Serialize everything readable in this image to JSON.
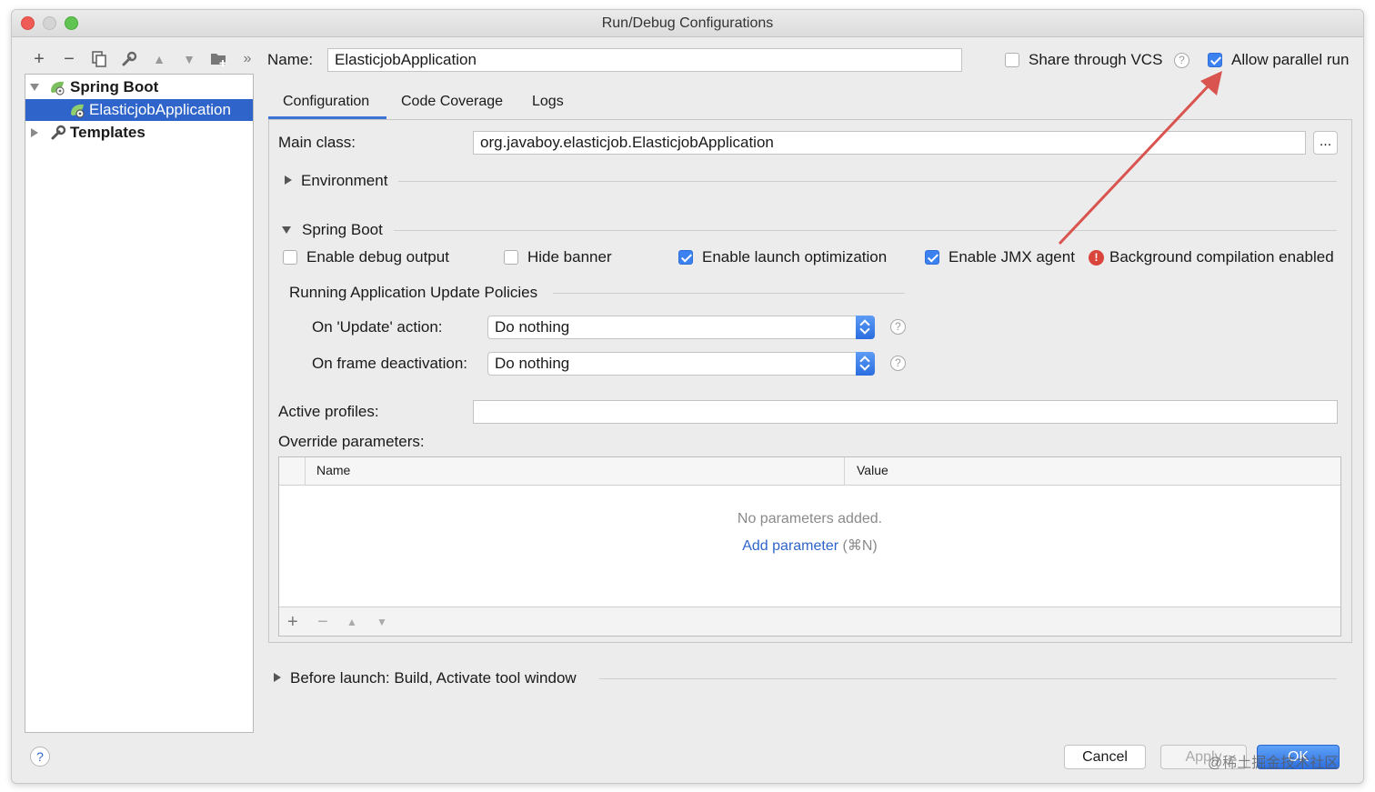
{
  "window": {
    "title": "Run/Debug Configurations"
  },
  "tree": {
    "groups": [
      {
        "label": "Spring Boot",
        "children": [
          {
            "label": "ElasticjobApplication",
            "selected": true
          }
        ]
      },
      {
        "label": "Templates"
      }
    ]
  },
  "header": {
    "name_label": "Name:",
    "name_value": "ElasticjobApplication",
    "share_vcs_label": "Share through VCS",
    "share_vcs_checked": false,
    "allow_parallel_label": "Allow parallel run",
    "allow_parallel_checked": true
  },
  "tabs": [
    {
      "label": "Configuration",
      "active": true
    },
    {
      "label": "Code Coverage",
      "active": false
    },
    {
      "label": "Logs",
      "active": false
    }
  ],
  "config": {
    "main_class_label": "Main class:",
    "main_class_value": "org.javaboy.elasticjob.ElasticjobApplication",
    "browse_label": "...",
    "environment_label": "Environment",
    "spring_boot_label": "Spring Boot",
    "options": [
      {
        "label": "Enable debug output",
        "checked": false
      },
      {
        "label": "Hide banner",
        "checked": false
      },
      {
        "label": "Enable launch optimization",
        "checked": true
      },
      {
        "label": "Enable JMX agent",
        "checked": true
      }
    ],
    "bg_compilation_icon": "!",
    "bg_compilation_label": "Background compilation enabled",
    "update_policies_label": "Running Application Update Policies",
    "on_update_label": "On 'Update' action:",
    "on_update_value": "Do nothing",
    "on_frame_label": "On frame deactivation:",
    "on_frame_value": "Do nothing",
    "help_glyph": "?",
    "active_profiles_label": "Active profiles:",
    "active_profiles_value": "",
    "override_label": "Override parameters:",
    "table": {
      "columns": [
        "Name",
        "Value"
      ],
      "empty_text": "No parameters added.",
      "add_link": "Add parameter",
      "add_shortcut": "(⌘N)"
    },
    "table_toolbar": {
      "add": "+",
      "remove": "−",
      "up": "▲",
      "down": "▼"
    }
  },
  "before_launch_label": "Before launch: Build, Activate tool window",
  "footer": {
    "help_glyph": "?",
    "cancel_label": "Cancel",
    "apply_label": "Apply",
    "ok_label": "OK"
  },
  "toolbar": {
    "add": "+",
    "remove": "−",
    "more": "»"
  },
  "watermark": "@稀土掘金技术社区",
  "colors": {
    "accent": "#2f65ca",
    "selection": "#2f65ca",
    "annotation_arrow": "#d9534f",
    "error": "#d9443b"
  }
}
